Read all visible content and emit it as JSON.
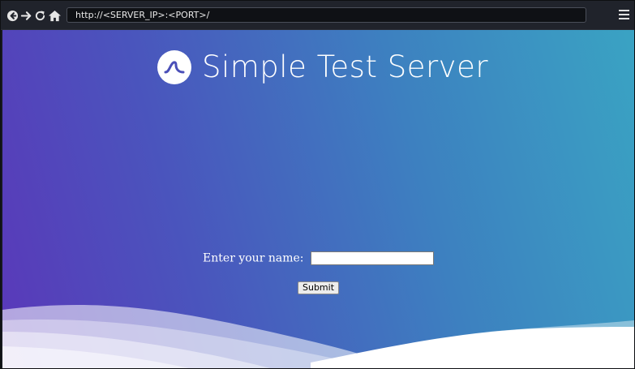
{
  "browser": {
    "url": "http://<SERVER_IP>:<PORT>/",
    "icons": [
      "back-icon",
      "forward-icon",
      "reload-icon",
      "home-icon",
      "menu-icon"
    ]
  },
  "header": {
    "title": "Simple Test Server",
    "logo": "wave-logo-icon"
  },
  "form": {
    "name_label": "Enter your name:",
    "name_value": "",
    "submit_label": "Submit"
  },
  "colors": {
    "toolbar_bg": "#20232b",
    "gradient_start": "#5a38b9",
    "gradient_end": "#3aa3c3",
    "text": "#ffffff"
  }
}
